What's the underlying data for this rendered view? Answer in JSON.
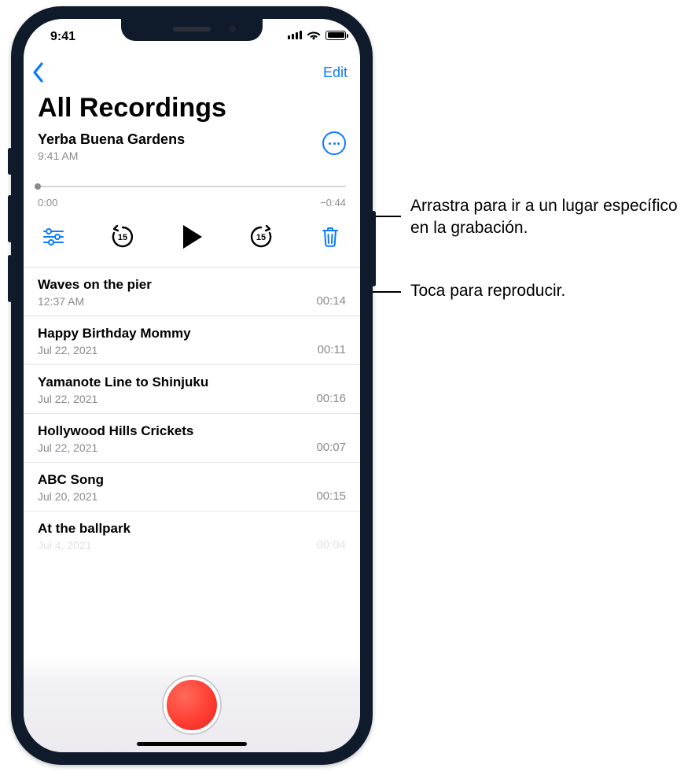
{
  "status": {
    "time": "9:41"
  },
  "nav": {
    "edit": "Edit"
  },
  "page_title": "All Recordings",
  "expanded": {
    "name": "Yerba Buena Gardens",
    "subtitle": "9:41 AM",
    "time_elapsed": "0:00",
    "time_remaining": "−0:44",
    "skip_seconds": "15"
  },
  "list": [
    {
      "name": "Waves on the pier",
      "subtitle": "12:37 AM",
      "duration": "00:14"
    },
    {
      "name": "Happy Birthday Mommy",
      "subtitle": "Jul 22, 2021",
      "duration": "00:11"
    },
    {
      "name": "Yamanote Line to Shinjuku",
      "subtitle": "Jul 22, 2021",
      "duration": "00:16"
    },
    {
      "name": "Hollywood Hills Crickets",
      "subtitle": "Jul 22, 2021",
      "duration": "00:07"
    },
    {
      "name": "ABC Song",
      "subtitle": "Jul 20, 2021",
      "duration": "00:15"
    },
    {
      "name": "At the ballpark",
      "subtitle": "Jul 4, 2021",
      "duration": "00:04"
    }
  ],
  "callouts": {
    "scrub": "Arrastra para ir a un lugar específico en la grabación.",
    "play": "Toca para reproducir."
  }
}
